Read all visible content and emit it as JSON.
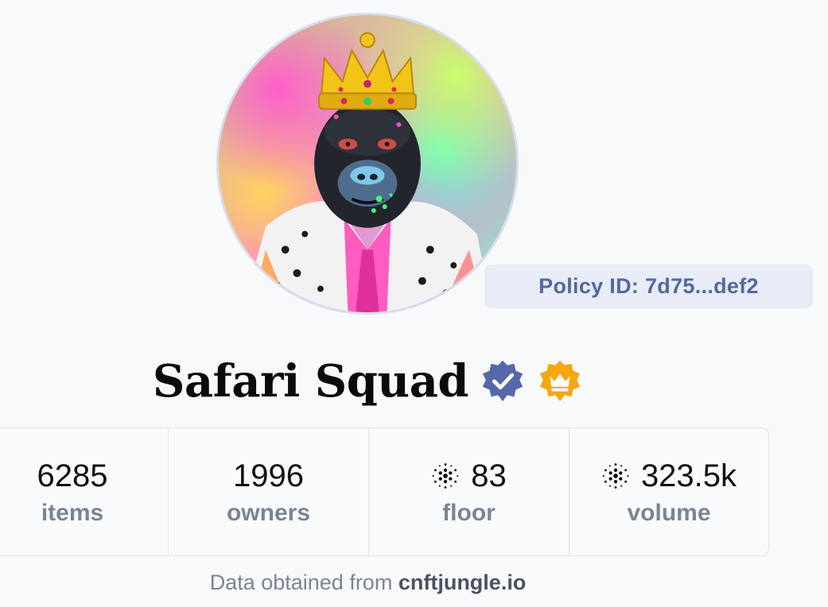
{
  "collection": {
    "name": "Safari Squad",
    "policy_id_label": "Policy ID: 7d75...def2",
    "avatar_alt": "crowned-gorilla-avatar",
    "verified_badge_color": "#5568a8",
    "royalty_badge_color": "#f5a70f"
  },
  "stats": [
    {
      "value": "6285",
      "label": "items",
      "ada": false
    },
    {
      "value": "1996",
      "label": "owners",
      "ada": false
    },
    {
      "value": "83",
      "label": "floor",
      "ada": true
    },
    {
      "value": "323.5k",
      "label": "volume",
      "ada": true
    }
  ],
  "footer": {
    "prefix": "Data obtained from ",
    "source": "cnftjungle.io"
  }
}
